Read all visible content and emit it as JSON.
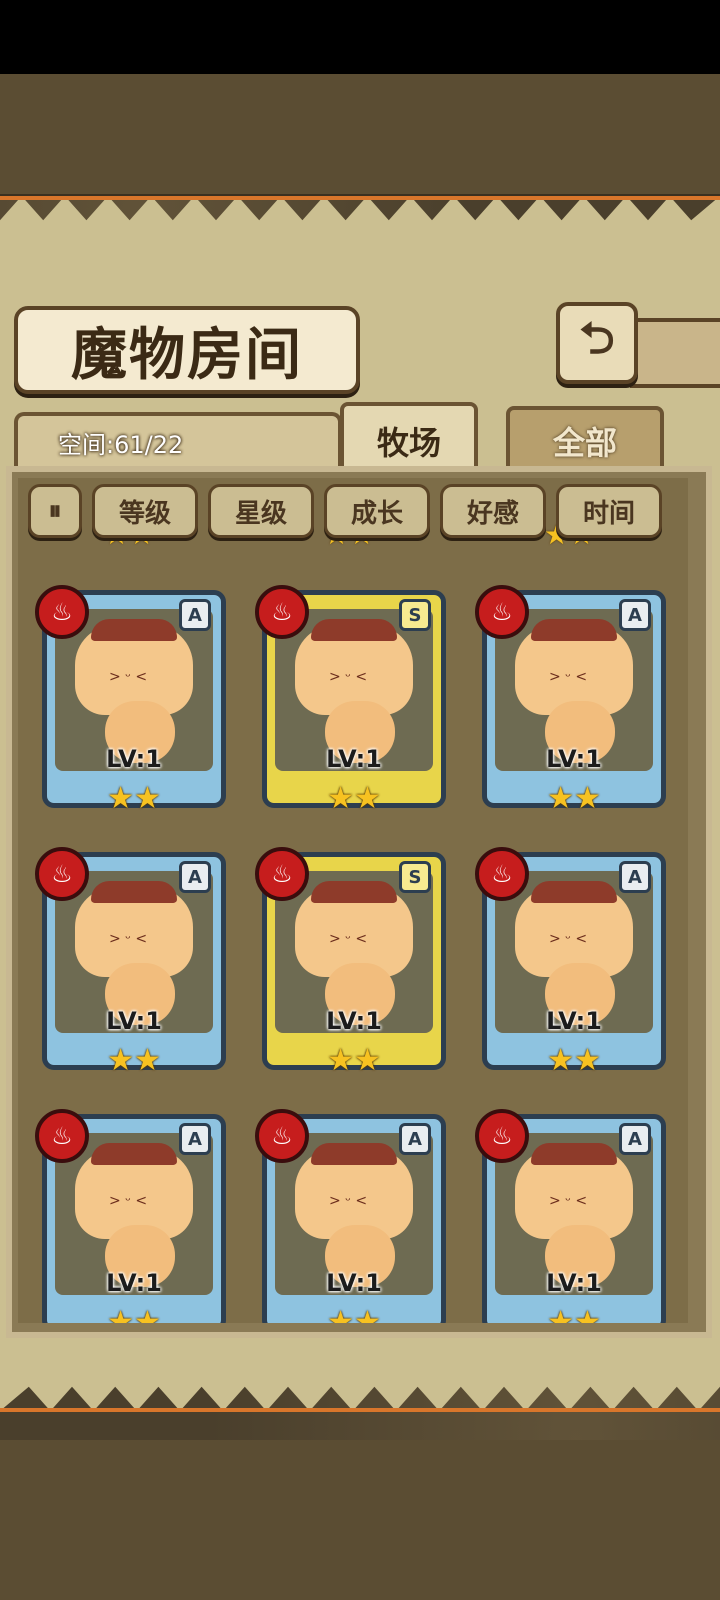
{
  "header": {
    "title": "魔物房间",
    "back_icon": "back-arrow-icon"
  },
  "space": {
    "label": "空间:61/22"
  },
  "tabs": [
    {
      "label": "牧场",
      "active": true
    },
    {
      "label": "全部",
      "active": false
    }
  ],
  "sort_buttons": [
    {
      "label": "",
      "icon": "sort-order-icon"
    },
    {
      "label": "等级"
    },
    {
      "label": "星级"
    },
    {
      "label": "成长"
    },
    {
      "label": "好感"
    },
    {
      "label": "时间"
    }
  ],
  "cards": [
    {
      "rank": "A",
      "level": "LV:1",
      "stars": "★★",
      "element": "fire-icon"
    },
    {
      "rank": "S",
      "level": "LV:1",
      "stars": "★★",
      "element": "fire-icon"
    },
    {
      "rank": "A",
      "level": "LV:1",
      "stars": "★★",
      "element": "fire-icon"
    },
    {
      "rank": "A",
      "level": "LV:1",
      "stars": "★★",
      "element": "fire-icon"
    },
    {
      "rank": "S",
      "level": "LV:1",
      "stars": "★★",
      "element": "fire-icon"
    },
    {
      "rank": "A",
      "level": "LV:1",
      "stars": "★★",
      "element": "fire-icon"
    },
    {
      "rank": "A",
      "level": "LV:1",
      "stars": "★★",
      "element": "fire-icon"
    },
    {
      "rank": "A",
      "level": "LV:1",
      "stars": "★★",
      "element": "fire-icon"
    },
    {
      "rank": "A",
      "level": "LV:1",
      "stars": "★★",
      "element": "fire-icon"
    }
  ]
}
